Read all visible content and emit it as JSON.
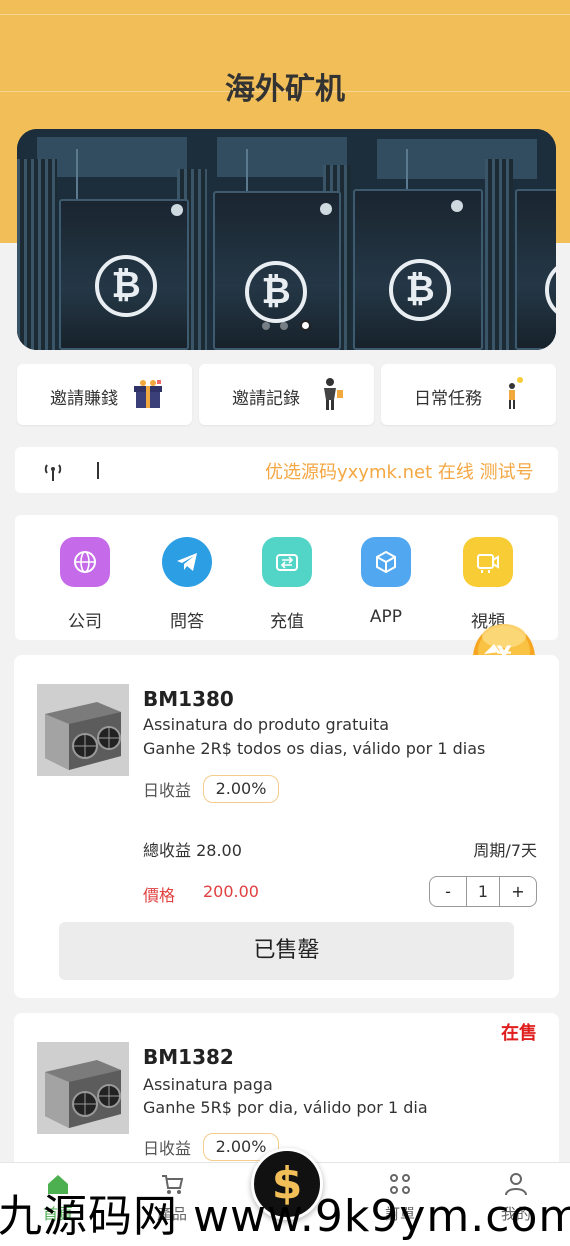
{
  "header": {
    "title": "海外矿机",
    "bg_color": "#f2be58"
  },
  "banner": {
    "image": "bitcoin-mining-rig-photo",
    "slides": 3,
    "active_slide": 3
  },
  "quick_actions": [
    {
      "label": "邀請賺錢",
      "icon": "gift-box-icon"
    },
    {
      "label": "邀請記錄",
      "icon": "person-figure-icon"
    },
    {
      "label": "日常任務",
      "icon": "person-lightbulb-icon"
    }
  ],
  "notice": {
    "icon": "broadcast-icon",
    "text": "优选源码yxymk.net 在线 测试号"
  },
  "menu": [
    {
      "label": "公司",
      "icon": "globe-icon",
      "color": "#c56ae8"
    },
    {
      "label": "問答",
      "icon": "telegram-icon",
      "color": "#2c9ee3"
    },
    {
      "label": "充值",
      "icon": "wallet-icon",
      "color": "#52d4c6"
    },
    {
      "label": "APP",
      "icon": "cube-icon",
      "color": "#52a8f0"
    },
    {
      "label": "視頻",
      "icon": "video-icon",
      "color": "#f7cc35"
    }
  ],
  "float_badge": {
    "icon": "coin-bag-icon",
    "text": "¥"
  },
  "products": [
    {
      "name": "BM1380",
      "desc1": "Assinatura do produto gratuita",
      "desc2": "Ganhe 2R$ todos os dias, válido por 1 dias",
      "rate_label": "日收益",
      "rate": "2.00%",
      "total_label": "總收益",
      "total": "28.00",
      "period": "周期/7天",
      "price_label": "價格",
      "price": "200.00",
      "qty_minus": "-",
      "qty": "1",
      "qty_plus": "+",
      "button": "已售罄"
    },
    {
      "name": "BM1382",
      "status": "在售",
      "desc1": "Assinatura paga",
      "desc2": "Ganhe 5R$ por dia, válido por 1 dia",
      "rate_label": "日收益",
      "rate": "2.00%"
    }
  ],
  "tabbar": [
    {
      "label": "首頁",
      "icon": "home-icon",
      "active": true
    },
    {
      "label": "產品",
      "icon": "cart-icon"
    },
    {
      "label": "",
      "icon": "dollar-icon",
      "center_text": "$"
    },
    {
      "label": "訂單",
      "icon": "grid-dots-icon"
    },
    {
      "label": "我的",
      "icon": "user-icon"
    }
  ],
  "watermark": "九源码网 www.9k9ym.com"
}
